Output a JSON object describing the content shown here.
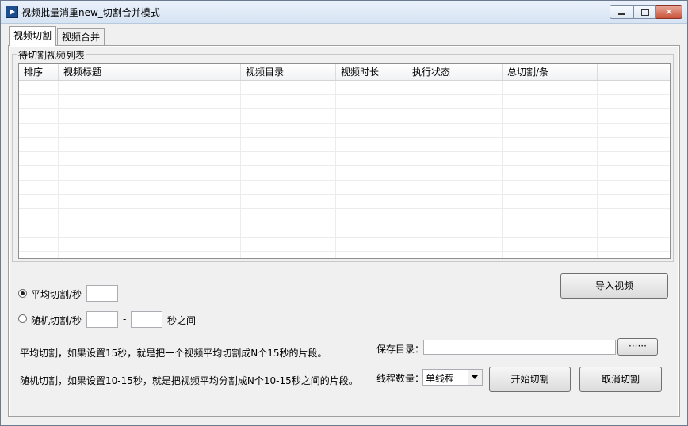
{
  "window": {
    "title": "视频批量消重new_切割合并模式",
    "controls": {
      "minimize": "minimize",
      "maximize": "maximize",
      "close": "✕"
    }
  },
  "tabs": [
    {
      "label": "视频切割",
      "active": true
    },
    {
      "label": "视频合并",
      "active": false
    }
  ],
  "list_group": {
    "label": "待切割视频列表",
    "columns": [
      "排序",
      "视频标题",
      "视频目录",
      "视频时长",
      "执行状态",
      "总切割/条"
    ],
    "rows": []
  },
  "options": {
    "average": {
      "label": "平均切割/秒",
      "value": "",
      "selected": true
    },
    "random": {
      "label": "随机切割/秒",
      "min": "",
      "max": "",
      "dash": "-",
      "suffix": "秒之间",
      "selected": false
    }
  },
  "help": {
    "line1": "平均切割，如果设置15秒，就是把一个视频平均切割成N个15秒的片段。",
    "line2": "随机切割，如果设置10-15秒，就是把视频平均分割成N个10-15秒之间的片段。"
  },
  "save_dir": {
    "label": "保存目录：",
    "value": "",
    "browse_label": "······"
  },
  "threads": {
    "label": "线程数量：",
    "selected": "单线程"
  },
  "buttons": {
    "import": "导入视频",
    "start": "开始切割",
    "cancel": "取消切割"
  },
  "colors": {
    "titlebar": "#dae6f4",
    "close_button": "#c85339",
    "panel": "#f0f0f0"
  }
}
